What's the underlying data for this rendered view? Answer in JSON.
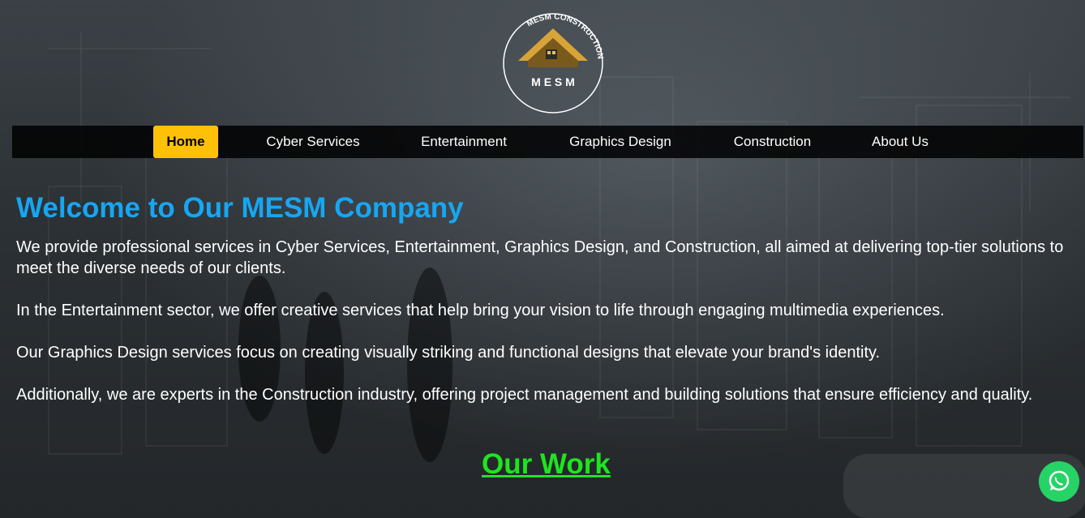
{
  "brand": {
    "arc_text": "MESM CONSTRUCTION",
    "mark_text": "M E S M",
    "logo_icon": "house-roof-icon"
  },
  "nav": {
    "items": [
      {
        "label": "Home",
        "active": true
      },
      {
        "label": "Cyber Services",
        "active": false
      },
      {
        "label": "Entertainment",
        "active": false
      },
      {
        "label": "Graphics Design",
        "active": false
      },
      {
        "label": "Construction",
        "active": false
      },
      {
        "label": "About Us",
        "active": false
      }
    ]
  },
  "main": {
    "title": "Welcome to Our MESM Company",
    "paragraphs": [
      "We provide professional services in Cyber Services, Entertainment, Graphics Design, and Construction, all aimed at delivering top-tier solutions to meet the diverse needs of our clients.",
      "In the Entertainment sector, we offer creative services that help bring your vision to life through engaging multimedia experiences.",
      "Our Graphics Design services focus on creating visually striking and functional designs that elevate your brand's identity.",
      "Additionally, we are experts in the Construction industry, offering project management and building solutions that ensure efficiency and quality."
    ],
    "section_heading": "Our Work"
  },
  "floating": {
    "icon": "whatsapp-icon"
  },
  "colors": {
    "accent": "#ffc107",
    "title_blue": "#17a6f2",
    "work_green": "#1ee51e",
    "whatsapp_green": "#25d366"
  }
}
